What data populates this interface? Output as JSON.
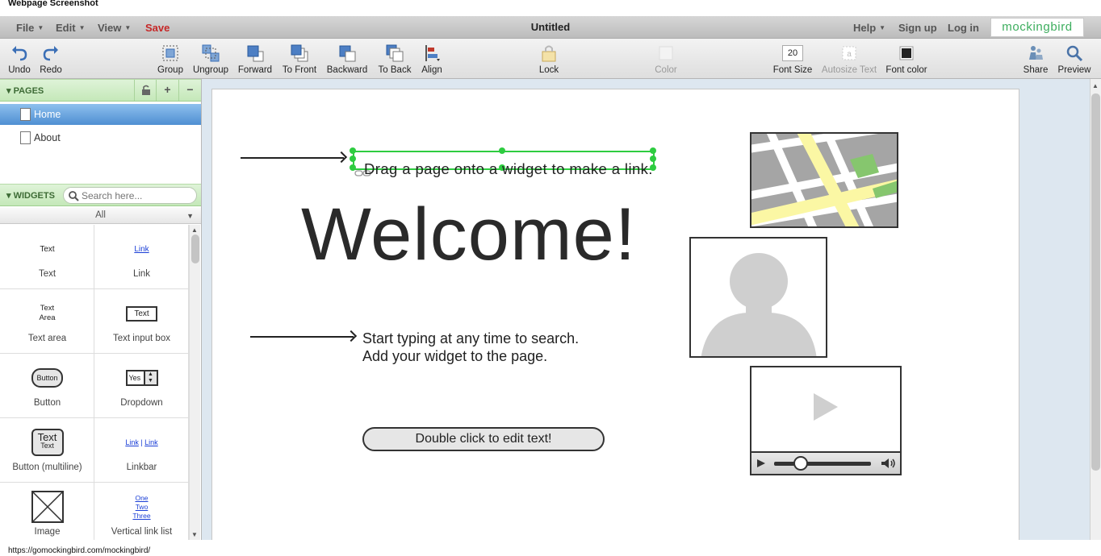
{
  "screenshot_title": "Webpage Screenshot",
  "menubar": {
    "file": "File",
    "edit": "Edit",
    "view": "View",
    "save": "Save",
    "doc_title": "Untitled",
    "help": "Help",
    "signup": "Sign up",
    "login": "Log in",
    "brand": "mockingbird"
  },
  "toolbar": {
    "undo": "Undo",
    "redo": "Redo",
    "group": "Group",
    "ungroup": "Ungroup",
    "forward": "Forward",
    "to_front": "To Front",
    "backward": "Backward",
    "to_back": "To Back",
    "align": "Align",
    "lock": "Lock",
    "color": "Color",
    "font_size_value": "20",
    "font_size": "Font Size",
    "autosize": "Autosize Text",
    "font_color": "Font color",
    "font_color_hex": "#222222",
    "share": "Share",
    "preview": "Preview"
  },
  "pages": {
    "header": "PAGES",
    "add": "+",
    "remove": "−",
    "items": [
      {
        "label": "Home",
        "selected": true
      },
      {
        "label": "About",
        "selected": false
      }
    ]
  },
  "widgets": {
    "header": "WIDGETS",
    "search_placeholder": "Search here...",
    "filter": "All",
    "items": [
      {
        "label": "Text",
        "preview": "Text"
      },
      {
        "label": "Link",
        "preview": "Link"
      },
      {
        "label": "Text area",
        "preview": "Text\nArea"
      },
      {
        "label": "Text input box",
        "preview": "Text"
      },
      {
        "label": "Button",
        "preview": "Button"
      },
      {
        "label": "Dropdown",
        "preview": "Yes"
      },
      {
        "label": "Button (multiline)",
        "preview_top": "Text",
        "preview_bottom": "Text"
      },
      {
        "label": "Linkbar",
        "preview_a": "Link",
        "preview_b": "Link"
      },
      {
        "label": "Image"
      },
      {
        "label": "Vertical link list",
        "links": [
          "One",
          "Two",
          "Three"
        ]
      }
    ]
  },
  "canvas": {
    "hint_link": "Drag a page onto a widget to make a link.",
    "welcome": "Welcome!",
    "hint_search_line1": "Start typing at any time to search.",
    "hint_search_line2": "Add your widget to the page.",
    "button_text": "Double click to edit text!"
  },
  "status_url": "https://gomockingbird.com/mockingbird/",
  "colors": {
    "accent_green": "#2ecc40",
    "save_red": "#c62828",
    "brand_green": "#3dae5e",
    "selected_blue": "#4f8fd2"
  }
}
